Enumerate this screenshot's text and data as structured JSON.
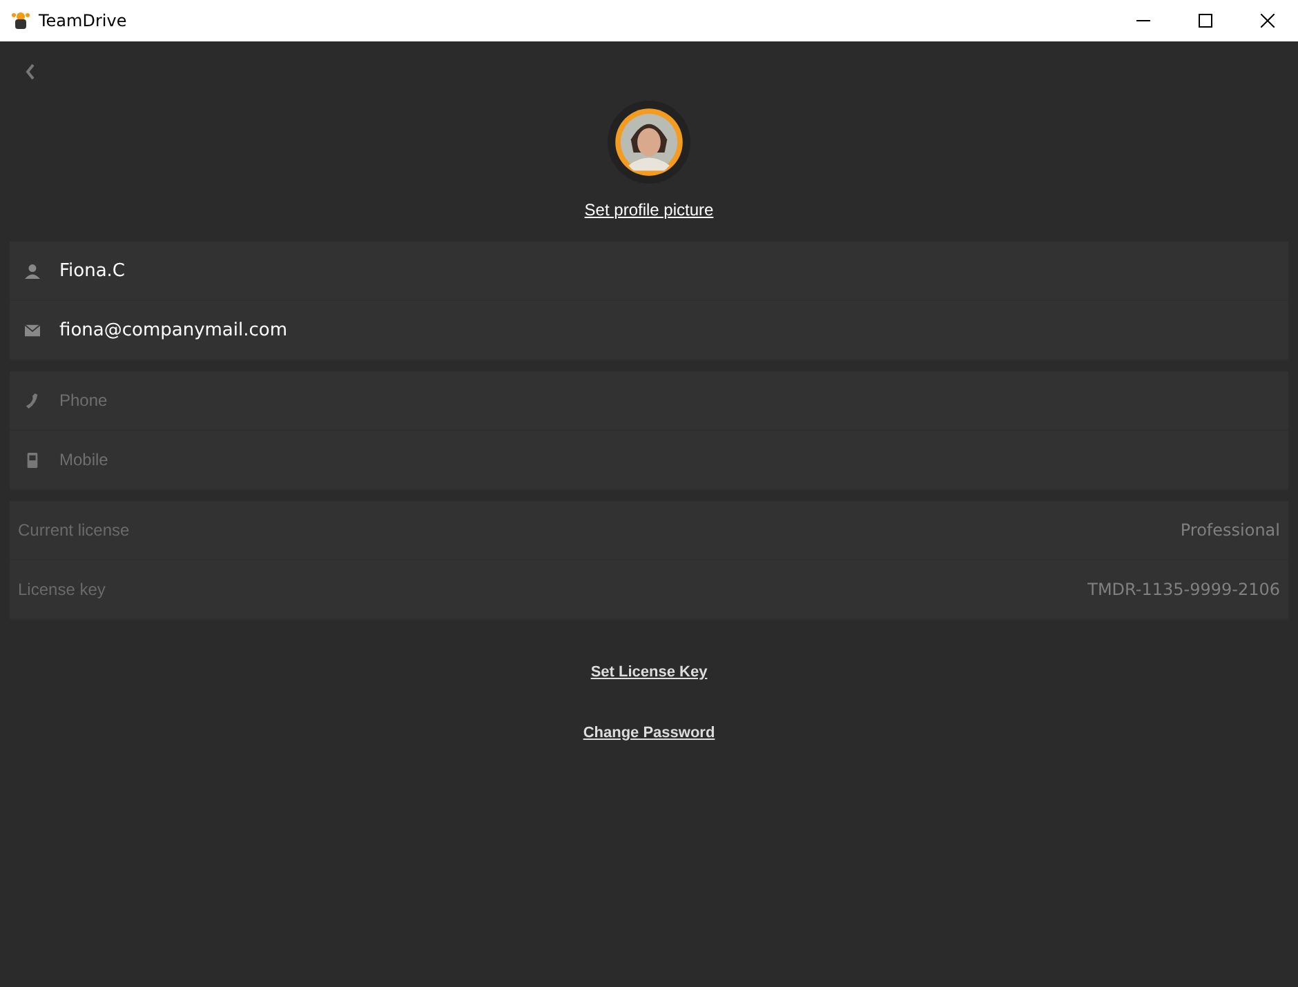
{
  "window": {
    "title": "TeamDrive"
  },
  "profile": {
    "link": "Set profile picture"
  },
  "contact_fields": [
    {
      "kind": "user",
      "value": "Fiona.C"
    },
    {
      "kind": "mail",
      "value": "fiona@companymail.com"
    }
  ],
  "phone_fields": [
    {
      "kind": "phone",
      "placeholder": "Phone"
    },
    {
      "kind": "mobile",
      "placeholder": "Mobile"
    }
  ],
  "license": [
    {
      "label": "Current license",
      "value": "Professional"
    },
    {
      "label": "License key",
      "value": "TMDR-1135-9999-2106"
    }
  ],
  "links": [
    "Set License Key",
    "Change Password"
  ]
}
